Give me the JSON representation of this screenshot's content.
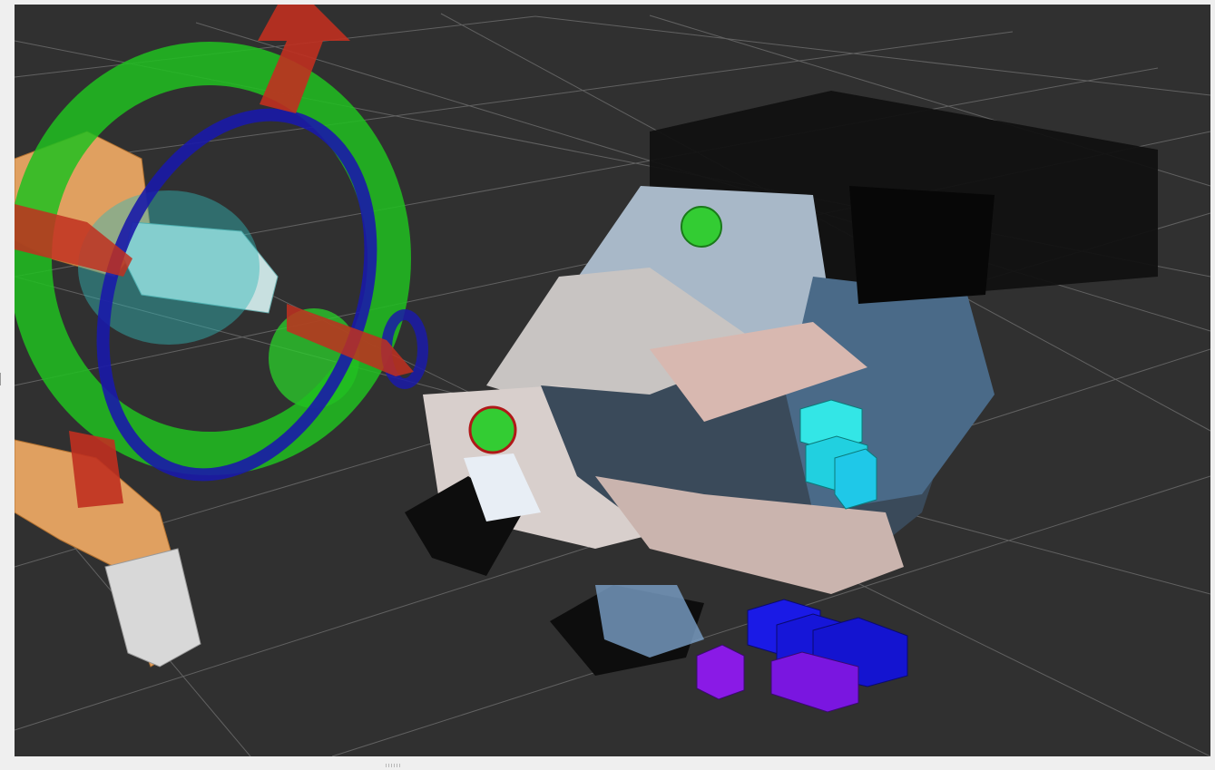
{
  "app": {
    "panel": "3d-render-viewport",
    "background_color": "#303030",
    "frame_color": "#efefef"
  },
  "scene": {
    "grid_color": "#8a8a8a",
    "interactive_marker": {
      "ring_x_color": "#20c020",
      "ring_y_color": "#1a1aa8",
      "arrow_color": "#c03020"
    },
    "robot_arm": {
      "link_color": "#e0a060",
      "tool_color": "#d8d8d8"
    },
    "goal_markers_color": "#33cc33",
    "voxel_colors": [
      "#33e6e6",
      "#1a1ae6",
      "#8a1ae6"
    ]
  }
}
